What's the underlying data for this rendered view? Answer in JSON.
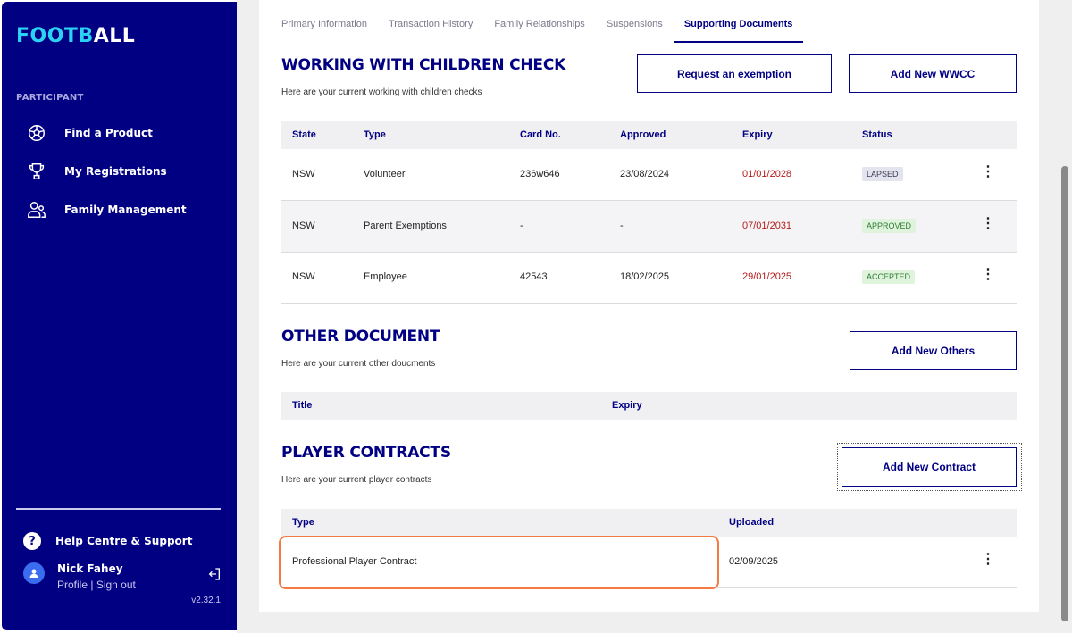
{
  "sidebar": {
    "logo_part1": "FOOTB",
    "logo_part2": "ALL",
    "section": "PARTICIPANT",
    "items": [
      {
        "label": "Find a Product",
        "icon": "football-icon"
      },
      {
        "label": "My Registrations",
        "icon": "trophy-icon"
      },
      {
        "label": "Family Management",
        "icon": "family-icon"
      }
    ],
    "help": "Help Centre & Support",
    "user_name": "Nick Fahey",
    "profile": "Profile",
    "separator": "|",
    "signout": "Sign out",
    "version": "v2.32.1"
  },
  "tabs": [
    "Primary Information",
    "Transaction History",
    "Family Relationships",
    "Suspensions",
    "Supporting Documents"
  ],
  "active_tab": "Supporting Documents",
  "wwcc": {
    "title": "WORKING WITH CHILDREN CHECK",
    "subtitle": "Here are your current working with children checks",
    "btn_exemption": "Request an exemption",
    "btn_add": "Add New WWCC",
    "headers": [
      "State",
      "Type",
      "Card No.",
      "Approved",
      "Expiry",
      "Status"
    ],
    "rows": [
      {
        "state": "NSW",
        "type": "Volunteer",
        "card": "236w646",
        "approved": "23/08/2024",
        "expiry": "01/01/2028",
        "status": "LAPSED"
      },
      {
        "state": "NSW",
        "type": "Parent Exemptions",
        "card": "-",
        "approved": "-",
        "expiry": "07/01/2031",
        "status": "APPROVED"
      },
      {
        "state": "NSW",
        "type": "Employee",
        "card": "42543",
        "approved": "18/02/2025",
        "expiry": "29/01/2025",
        "status": "ACCEPTED"
      }
    ]
  },
  "other": {
    "title": "OTHER DOCUMENT",
    "subtitle": "Here are your current other doucments",
    "btn_add": "Add New Others",
    "headers": [
      "Title",
      "Expiry"
    ]
  },
  "contracts": {
    "title": "PLAYER CONTRACTS",
    "subtitle": "Here are your current player contracts",
    "btn_add": "Add New Contract",
    "headers": [
      "Type",
      "Uploaded"
    ],
    "rows": [
      {
        "type": "Professional Player Contract",
        "uploaded": "02/09/2025"
      }
    ]
  },
  "kebab": "⋮",
  "colors": {
    "brand": "#020082",
    "accent": "#2ad2f4",
    "expiry": "#b31b1b",
    "highlight": "#f47a43"
  }
}
